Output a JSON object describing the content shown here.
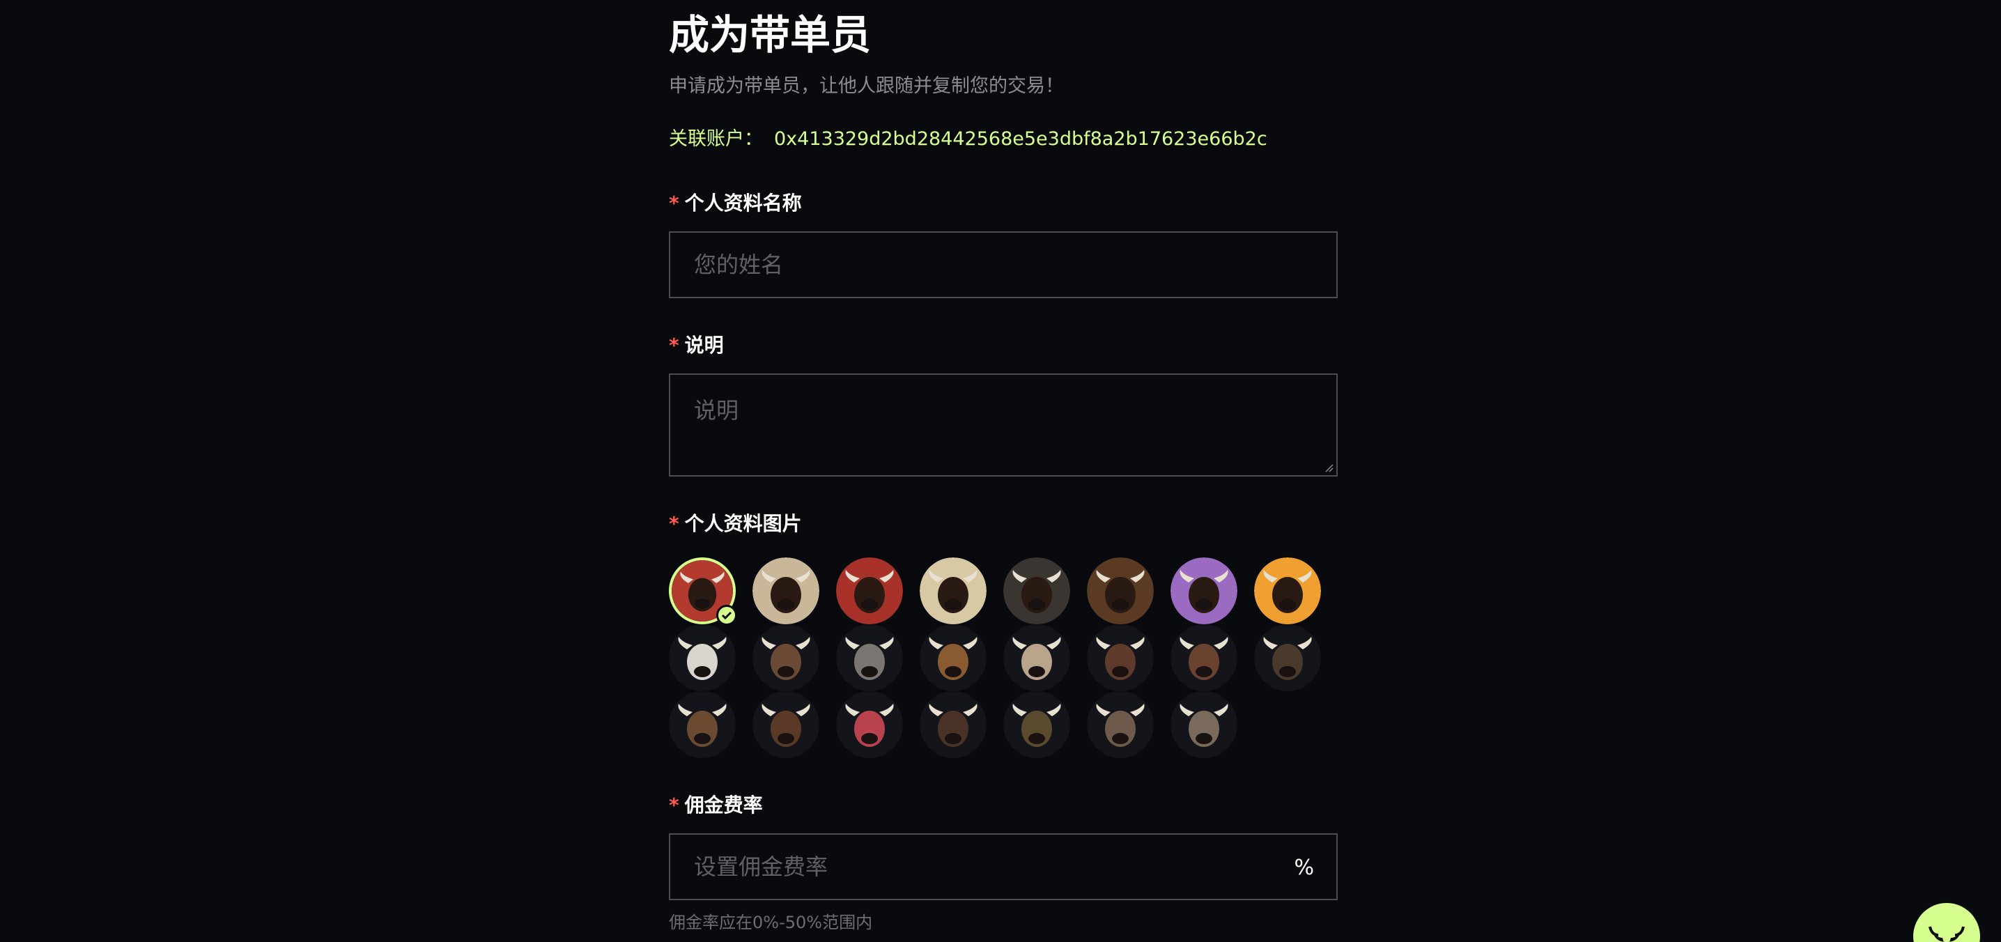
{
  "page": {
    "title": "成为带单员",
    "subtitle": "申请成为带单员，让他人跟随并复制您的交易！",
    "account_label": "关联账户：",
    "account_value": "0x413329d2bd28442568e5e3dbf8a2b17623e66b2c"
  },
  "form": {
    "required_mark": "*",
    "profile_name": {
      "label": "个人资料名称",
      "placeholder": "您的姓名",
      "value": ""
    },
    "description": {
      "label": "说明",
      "placeholder": "说明",
      "value": ""
    },
    "profile_picture": {
      "label": "个人资料图片",
      "selected_index": 0,
      "avatars": [
        {
          "icon": "bull-red-avatar-icon",
          "color": "#b23a2e"
        },
        {
          "icon": "bull-sketch-avatar-icon",
          "color": "#c9b79a"
        },
        {
          "icon": "bull-red-blue-avatar-icon",
          "color": "#a8322a"
        },
        {
          "icon": "bull-mosaic-avatar-icon",
          "color": "#d8c9a5"
        },
        {
          "icon": "bull-dark-avatar-icon",
          "color": "#3a3530"
        },
        {
          "icon": "bull-brown-avatar-icon",
          "color": "#5a3a22"
        },
        {
          "icon": "bull-purple-avatar-icon",
          "color": "#9a6bc0"
        },
        {
          "icon": "bull-orange-avatar-icon",
          "color": "#f0a030"
        },
        {
          "icon": "highland-cow-white-avatar-icon",
          "color": "#d9d5cf"
        },
        {
          "icon": "highland-cow-striped-avatar-icon",
          "color": "#6b4a35"
        },
        {
          "icon": "highland-cow-plaid-avatar-icon",
          "color": "#7a7672"
        },
        {
          "icon": "highland-cow-gold-avatar-icon",
          "color": "#8a5a30"
        },
        {
          "icon": "highland-cow-suit-avatar-icon",
          "color": "#b8a58c"
        },
        {
          "icon": "highland-cow-robe-avatar-icon",
          "color": "#5e3b2a"
        },
        {
          "icon": "highland-cow-beard-avatar-icon",
          "color": "#6a4330"
        },
        {
          "icon": "highland-cow-hat-avatar-icon",
          "color": "#4a3a2c"
        },
        {
          "icon": "highland-cow-beret-avatar-icon",
          "color": "#6b4a32"
        },
        {
          "icon": "highland-cow-dark-avatar-icon",
          "color": "#5a3a26"
        },
        {
          "icon": "highland-cow-pink-avatar-icon",
          "color": "#b8434e"
        },
        {
          "icon": "highland-cow-tux-avatar-icon",
          "color": "#4a3326"
        },
        {
          "icon": "highland-cow-armor-avatar-icon",
          "color": "#5a4a2e"
        },
        {
          "icon": "highland-cow-grey-avatar-icon",
          "color": "#6e5a4a"
        },
        {
          "icon": "highland-cow-collar-avatar-icon",
          "color": "#7a6a5c"
        }
      ]
    },
    "commission_rate": {
      "label": "佣金费率",
      "placeholder": "设置佣金费率",
      "value": "",
      "suffix": "%",
      "hint": "佣金率应在0%-50%范围内"
    }
  },
  "floating_button": {
    "icon": "bull-logo-icon"
  },
  "colors": {
    "background": "#090a0e",
    "accent": "#d6ff8f",
    "required": "#ff5c4d",
    "border": "#4b4d54",
    "muted_text": "#8b8d93"
  }
}
